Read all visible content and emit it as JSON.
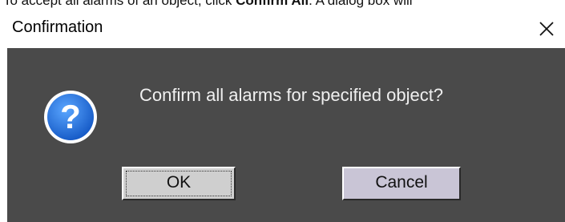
{
  "background_doc": {
    "text_before": "To accept all alarms of an object, click ",
    "text_bold": "Confirm All",
    "text_after": ". A dialog box will"
  },
  "dialog": {
    "title": "Confirmation",
    "close_glyph": "✕",
    "message": "Confirm all alarms for specified object?",
    "icon": "question-icon",
    "buttons": {
      "ok_label": "OK",
      "cancel_label": "Cancel"
    }
  },
  "colors": {
    "dialog_body": "#4a4a4a",
    "titlebar": "#ffffff",
    "icon_blue": "#1e6fd9",
    "button_face": "#cfcfcf",
    "cancel_face": "#c9c5d6",
    "message_text": "#f0f0f0"
  }
}
